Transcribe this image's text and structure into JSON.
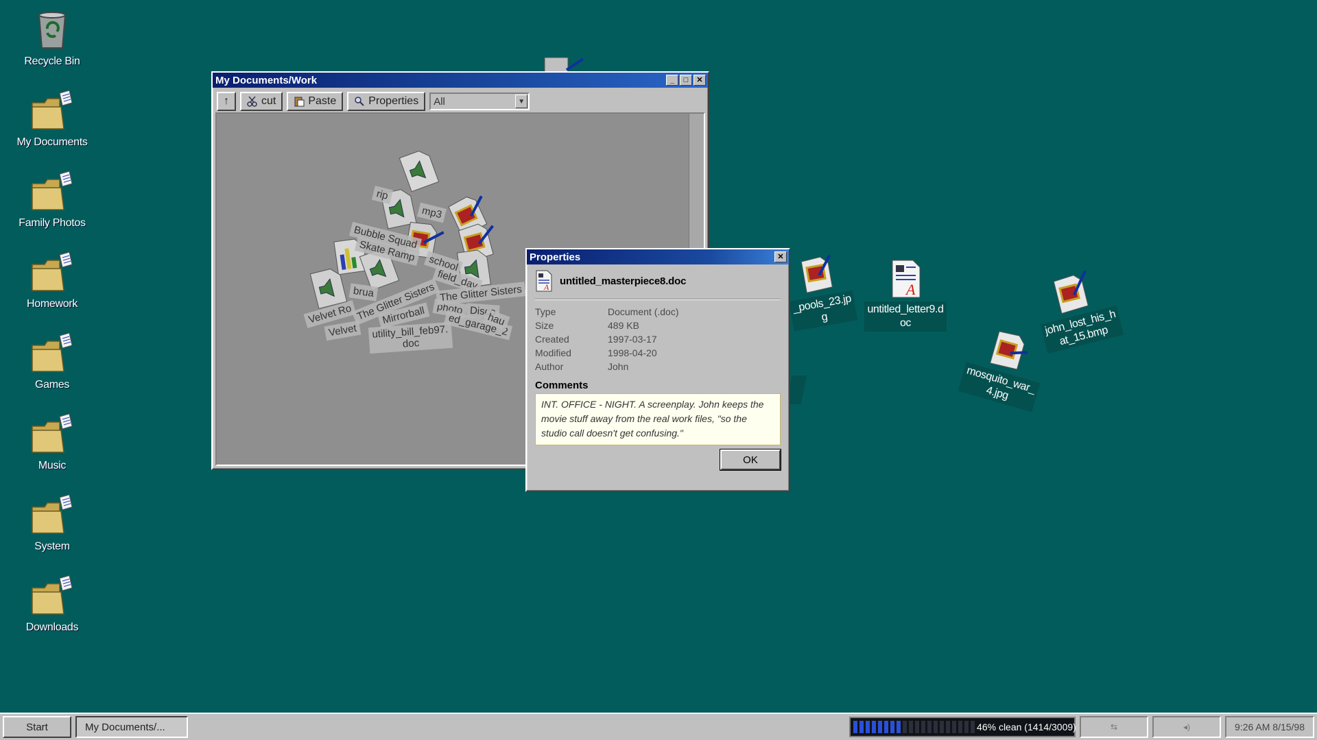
{
  "desktop": {
    "left_icons": [
      {
        "label": "Recycle Bin",
        "icon": "recycle-bin-icon"
      },
      {
        "label": "My Documents",
        "icon": "folder-icon"
      },
      {
        "label": "Family Photos",
        "icon": "folder-icon"
      },
      {
        "label": "Homework",
        "icon": "folder-icon"
      },
      {
        "label": "Games",
        "icon": "folder-icon"
      },
      {
        "label": "Music",
        "icon": "folder-icon"
      },
      {
        "label": "System",
        "icon": "folder-icon"
      },
      {
        "label": "Downloads",
        "icon": "folder-icon"
      }
    ],
    "loose_icons": [
      {
        "label": "_pools_23.jp\ng",
        "icon": "image-file-icon"
      },
      {
        "label": "untitled_letter9.d\noc",
        "icon": "document-file-icon"
      },
      {
        "label": "john_lost_his_h\nat_15.bmp",
        "icon": "image-file-icon"
      },
      {
        "label": "mosquito_war_\n4.jpg",
        "icon": "image-file-icon"
      }
    ]
  },
  "explorer": {
    "title": "My Documents/Work",
    "toolbar": {
      "up_label": "↑",
      "cut_label": "cut",
      "paste_label": "Paste",
      "properties_label": "Properties",
      "filter_value": "All"
    },
    "pile_labels": [
      "rip",
      "mp3",
      "Bubble Squad",
      "Skate Ramp",
      "school",
      "field_day",
      "brua",
      "The Glitter Sisters",
      "Disco",
      "Velvet Ro",
      "Velvet",
      "Mirrorball",
      "photo",
      "ed_garage_2",
      "utility_bill_feb97.\ndoc",
      "The Glitter Sisters",
      "hau"
    ]
  },
  "properties_dialog": {
    "title": "Properties",
    "filename": "untitled_masterpiece8.doc",
    "rows": [
      {
        "key": "Type",
        "value": "Document (.doc)"
      },
      {
        "key": "Size",
        "value": "489 KB"
      },
      {
        "key": "Created",
        "value": "1997-03-17"
      },
      {
        "key": "Modified",
        "value": "1998-04-20"
      },
      {
        "key": "Author",
        "value": "John"
      }
    ],
    "comments_heading": "Comments",
    "comments": "INT. OFFICE - NIGHT. A screenplay. John keeps the movie stuff away from the real work files, \"so the studio call doesn't get confusing.\"",
    "ok_label": "OK"
  },
  "taskbar": {
    "start_label": "Start",
    "task_label": "My Documents/...",
    "progress_text": "46% clean (1414/3009)",
    "progress_fraction": 0.46,
    "clock": "9:26 AM 8/15/98"
  }
}
